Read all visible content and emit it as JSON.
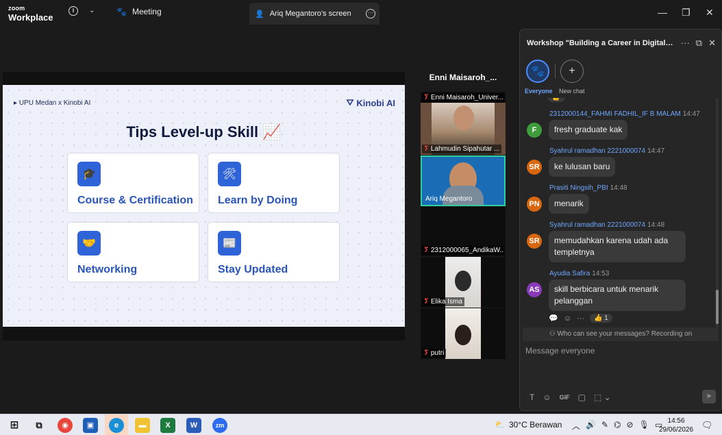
{
  "titlebar": {
    "brand_top": "zoom",
    "brand_bottom": "Workplace",
    "meeting_label": "Meeting",
    "screen_tab_label": "Ariq Megantoro's screen"
  },
  "slide": {
    "crumb": "UPU Medan x Kinobi AI",
    "brand": "Kinobi AI",
    "title": "Tips Level-up Skill",
    "cards": [
      {
        "label": "Course & Certification",
        "icon": "graduation-cap-icon",
        "glyph": "🎓"
      },
      {
        "label": "Learn by Doing",
        "icon": "tools-icon",
        "glyph": "🛠"
      },
      {
        "label": "Networking",
        "icon": "handshake-icon",
        "glyph": "🤝"
      },
      {
        "label": "Stay Updated",
        "icon": "newspaper-icon",
        "glyph": "📰"
      }
    ]
  },
  "participants": {
    "header": "Enni  Maisaroh_...",
    "tiles": [
      {
        "name": "Enni Maisaroh_Univer..."
      },
      {
        "name": "Lahmudin Sipahutar ..."
      },
      {
        "name": "Ariq Megantoro"
      },
      {
        "name": "2312000065_AndikaW..."
      },
      {
        "name": "Elika Isma"
      },
      {
        "name": "putri"
      }
    ]
  },
  "chat": {
    "title": "Workshop \"Building a Career in Digital Ma...",
    "audience": [
      {
        "label": "Everyone"
      },
      {
        "label": "New chat"
      }
    ],
    "messages": [
      {
        "sender": "2312000144_FAHMI FADHIL_IF B MALAM",
        "time": "14:47",
        "initials": "F",
        "color": "#3e9c3a",
        "text": "fresh graduate kak"
      },
      {
        "sender": "Syahrul ramadhan 2221000074",
        "time": "14:47",
        "initials": "SR",
        "color": "#d9670f",
        "text": "ke lulusan baru"
      },
      {
        "sender": "Prasiti Ningsih_PBI",
        "time": "14:48",
        "initials": "PN",
        "color": "#d9670f",
        "text": "menarik"
      },
      {
        "sender": "Syahrul ramadhan 2221000074",
        "time": "14:48",
        "initials": "SR",
        "color": "#d9670f",
        "text": "memudahkan karena udah ada templetnya"
      },
      {
        "sender": "Ayudia Safira",
        "time": "14:53",
        "initials": "AS",
        "color": "#8a3ab9",
        "text": "skill berbicara untuk menarik pelanggan"
      }
    ],
    "reaction_count": "1",
    "notice": "Who can see your messages? Recording on",
    "compose_placeholder": "Message everyone"
  },
  "taskbar": {
    "weather": "30°C  Berawan",
    "time": "14:56",
    "date": "29/06/2026"
  }
}
